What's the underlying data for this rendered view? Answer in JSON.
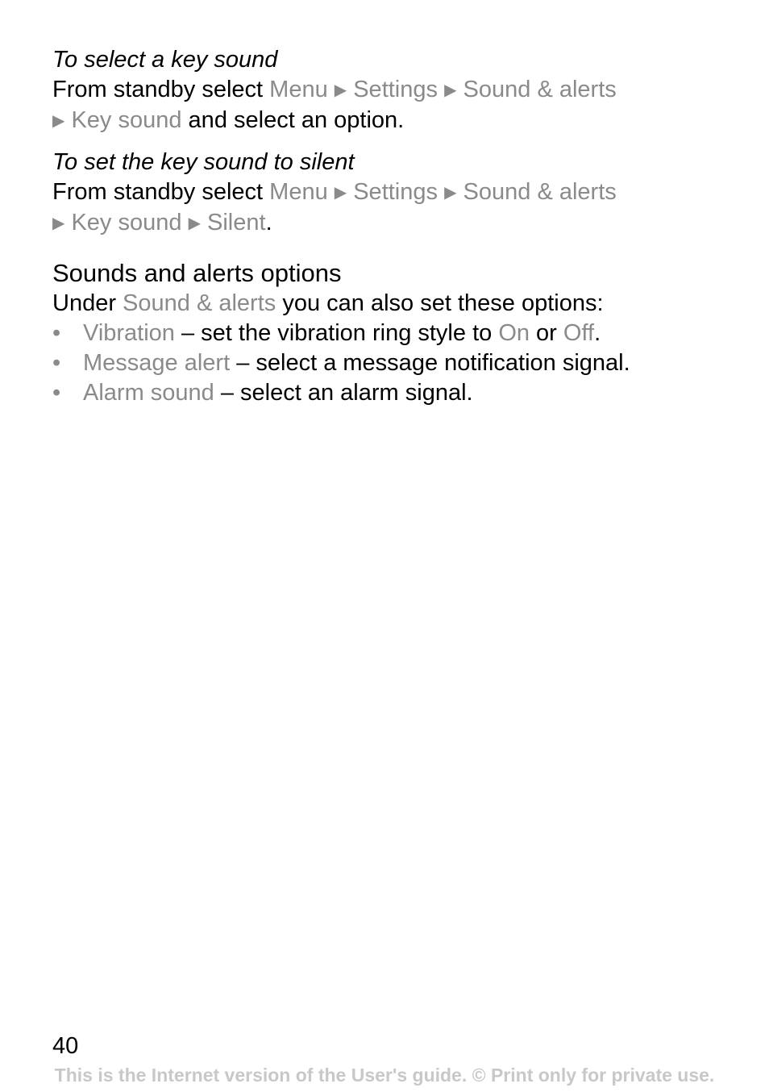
{
  "section1": {
    "title": "To select a key sound",
    "intro": "From standby select ",
    "path": [
      "Menu",
      "Settings",
      "Sound & alerts",
      "Key sound"
    ],
    "suffix": " and select an option."
  },
  "section2": {
    "title": "To set the key sound to silent",
    "intro": "From standby select ",
    "path": [
      "Menu",
      "Settings",
      "Sound & alerts",
      "Key sound",
      "Silent"
    ],
    "suffix": "."
  },
  "section3": {
    "heading": "Sounds and alerts options",
    "intro_pre": "Under ",
    "intro_link": "Sound & alerts",
    "intro_post": " you can also set these options:",
    "items": [
      {
        "term": "Vibration",
        "text": " – set the vibration ring style to ",
        "opt1": "On",
        "mid": " or ",
        "opt2": "Off",
        "end": "."
      },
      {
        "term": "Message alert",
        "text": " – select a message notification signal."
      },
      {
        "term": "Alarm sound",
        "text": " – select an alarm signal."
      }
    ]
  },
  "page_number": "40",
  "footer": "This is the Internet version of the User's guide. © Print only for private use.",
  "icons": {
    "arrow": "▶",
    "bullet": "•"
  }
}
